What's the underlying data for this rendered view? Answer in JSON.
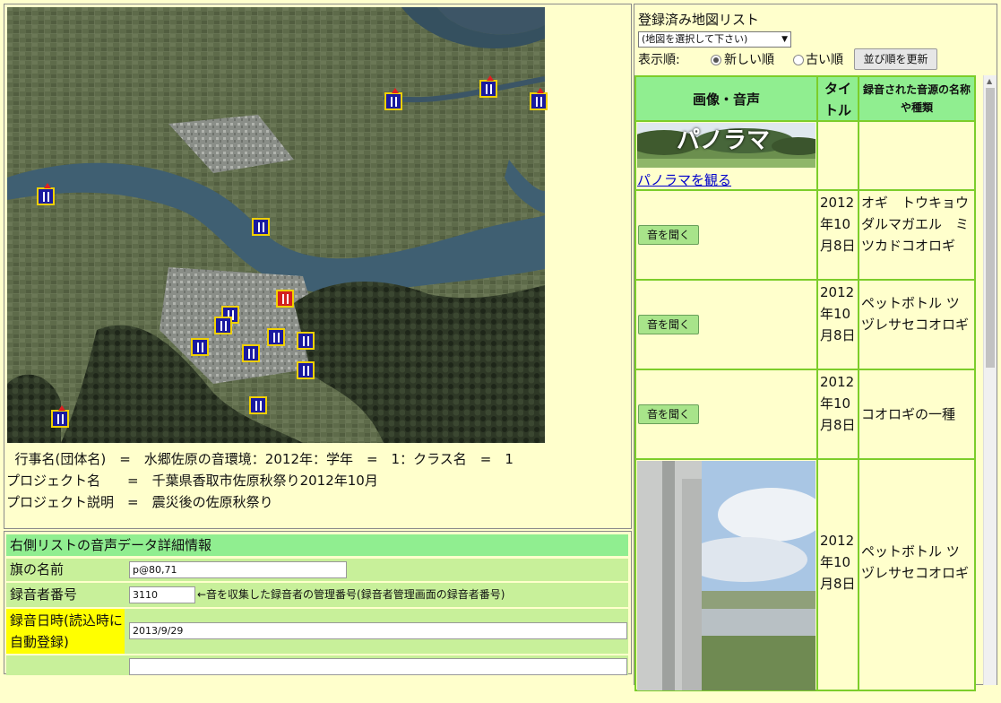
{
  "project": {
    "group_line": "  行事名(団体名)　=　水郷佐原の音環境：2012年：学年　=　1：クラス名　=　1",
    "name_line": "プロジェクト名　　=　千葉県香取市佐原秋祭り2012年10月",
    "desc_line": "プロジェクト説明　=　震災後の佐原秋祭り"
  },
  "detail": {
    "header": "右側リストの音声データ詳細情報",
    "flag_name_label": "旗の名前",
    "flag_name_value": "p@80,71",
    "recorder_label": "録音者番号",
    "recorder_value": "3110",
    "recorder_note": "←音を収集した録音者の管理番号(録音者管理画面の録音者番号)",
    "rec_date_label": "録音日時(読込時に自動登録)",
    "rec_date_value": "2013/9/29"
  },
  "map_list": {
    "title": "登録済み地図リスト",
    "select_value": "(地図を選択して下さい)",
    "order_label": "表示順:",
    "order_options": [
      "新しい順",
      "古い順"
    ],
    "order_selected": "新しい順",
    "update_button": "並び順を更新"
  },
  "table": {
    "headers": {
      "media": "画像・音声",
      "title": "タイトル",
      "source": "録音された音源の名称や種類"
    },
    "panorama_banner": "パノラマ",
    "panorama_link": "パノラマを観る",
    "listen_label": "音を聞く",
    "rows": [
      {
        "title": "2012年10月8日",
        "source": "オギ　トウキョウダルマガエル　ミツカドコオロギ"
      },
      {
        "title": "2012年10月8日",
        "source": "ペットボトル ツヅレサセコオロギ"
      },
      {
        "title": "2012年10月8日",
        "source": "コオロギの一種"
      },
      {
        "title": "2012年10月8日",
        "source": "ペットボトル ツヅレサセコオロギ"
      }
    ]
  },
  "colors": {
    "background": "#ffffcc",
    "table_border": "#7ccd2a",
    "header_green": "#90ee90",
    "detail_row": "#c8f09a",
    "highlight": "#ffff00",
    "flag_blue": "#1a1aa0",
    "flag_red": "#d22020",
    "flag_border": "#f0d000"
  },
  "icons": [
    "flag-marker-icon",
    "select-arrow-icon",
    "radio-icon"
  ]
}
